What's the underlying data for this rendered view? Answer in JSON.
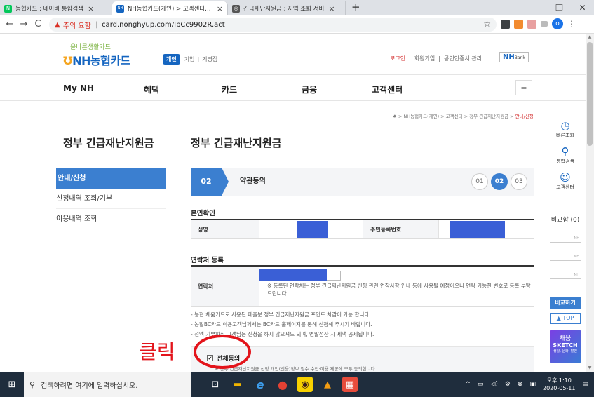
{
  "browser": {
    "tabs": [
      {
        "label": "농협카드 : 네이버 통합검색",
        "fav_color": "#03c75a",
        "fav_text": "N",
        "active": false
      },
      {
        "label": "NH농협카드(개인) > 고객센터 > 정",
        "fav_color": "#1565c0",
        "fav_text": "NH",
        "active": true
      },
      {
        "label": "긴급재난지원금 : 지역 조회 서비",
        "fav_color": "#555555",
        "fav_text": "◎",
        "active": false
      }
    ],
    "tab_close": "×",
    "new_tab": "+",
    "win_controls": [
      "–",
      "❐",
      "✕"
    ],
    "back": "←",
    "forward": "→",
    "reload": "C",
    "warning_icon": "▲",
    "warning_text": "주의 요함",
    "separator": "|",
    "url": "card.nonghyup.com/IpCc9902R.act",
    "star": "☆",
    "profile": "o",
    "menu": "⋮"
  },
  "header": {
    "logo_tag": "올바른생활카드",
    "logo_main_prefix": "Ʊ",
    "logo_main": "NH농협카드",
    "biz_active": "개인",
    "biz_items": [
      "기업",
      "|",
      "기명점"
    ],
    "util_items": [
      "로그인",
      "|",
      "회원가입",
      "|",
      "공인인증서 관리"
    ],
    "nhbank": "NH",
    "nhbank_small": "Bank"
  },
  "gnb": {
    "items": [
      "My NH",
      "혜택",
      "카드",
      "금융",
      "고객센터"
    ],
    "menu_icon": "≡"
  },
  "breadcrumb": {
    "home_icon": "♠",
    "path": " > NH농협카드(개인) > 고객센터 > 정부 긴급재난지원금 > ",
    "last": "안내/신청"
  },
  "sidebar": {
    "title": "정부 긴급재난지원금",
    "items": [
      "안내/신청",
      "신청내역 조회/기부",
      "이용내역 조회"
    ]
  },
  "main": {
    "title": "정부 긴급재난지원금",
    "step": {
      "current": "02",
      "name": "약관동의",
      "dots": [
        "01",
        "02",
        "03"
      ]
    },
    "identity": {
      "title": "본인확인",
      "name_label": "성명",
      "rrn_label": "주민등록번호"
    },
    "contact": {
      "title": "연락처 등록",
      "label": "연락처",
      "note": "※ 등록된 연락처는 정부 긴급재난지원금 신청 관련 연장사항 안내 등에 사용될 예정이오니 연락 가능한 번호로 등록 부탁드립니다."
    },
    "notes": [
      "- 농협 채움카드로 사용된 매출분 정부 긴급재난지원금 포인트 차감이 가능 합니다.",
      "- 농협BC카드 이용고객님께서는 BC카드 홈페이지를 통해 신청해 주시기 바랍니다.",
      "- 전액 기부하실 고객님은 신청을 하지 않으셔도 되며, 연말정산 시 세액 공제됩니다."
    ],
    "agree": {
      "check_mark": "✔",
      "label": "전체동의",
      "sub": "※ 정부 긴급재난지원금 신청 개인(신용)정보 필수 수집·이용 제공에 모두 동의합니다."
    },
    "annotation": "클릭"
  },
  "quick": {
    "items": [
      {
        "icon": "◷",
        "label": "빠른조회"
      },
      {
        "icon": "⚲",
        "label": "통합검색"
      },
      {
        "icon": "☺",
        "label": "고객센터"
      }
    ],
    "compare_title": "비교함 (0)",
    "slot_label": "NH",
    "compare_btn": "비교하기",
    "top_btn": "▲ TOP",
    "sketch_a": "채움",
    "sketch_b": "SKETCH",
    "sketch_c": "생활, 문화, 할인"
  },
  "taskbar": {
    "win_icon": "⊞",
    "search_icon": "⚲",
    "search_placeholder": "검색하려면 여기에 입력하십시오.",
    "apps": [
      {
        "name": "task-view-icon",
        "glyph": "⊡",
        "color": "#1f2d3d"
      },
      {
        "name": "file-explorer-icon",
        "glyph": "▬",
        "color": "#f0b400"
      },
      {
        "name": "ie-icon",
        "glyph": "e",
        "color": "#1f2d3d"
      },
      {
        "name": "chrome-icon",
        "glyph": "●",
        "color": "#e34133"
      },
      {
        "name": "kakaotalk-icon",
        "glyph": "◉",
        "color": "#f7d100"
      },
      {
        "name": "app-icon",
        "glyph": "▲",
        "color": "#f39c12"
      },
      {
        "name": "app-icon-2",
        "glyph": "▦",
        "color": "#e74c3c"
      }
    ],
    "tray_icons": [
      "^",
      "▭",
      "◁)",
      "⚙",
      "⊗",
      "▣"
    ],
    "time": "오후 1:10",
    "date": "2020-05-11",
    "notify": "▤"
  }
}
